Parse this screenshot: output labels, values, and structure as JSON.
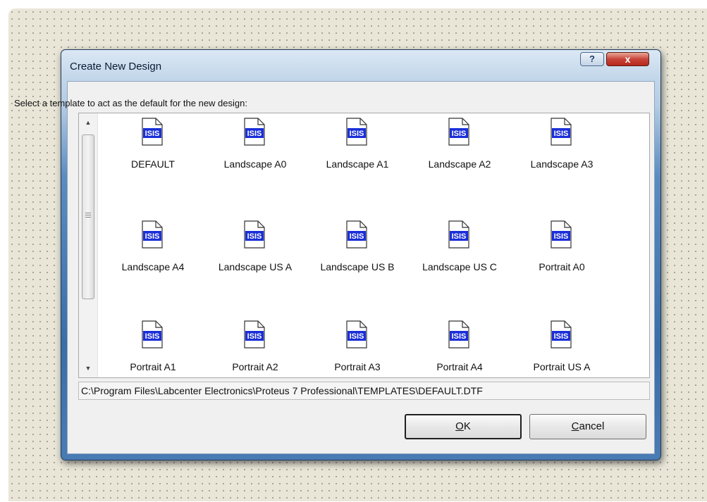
{
  "window": {
    "title": "Create New Design",
    "help_label": "?",
    "close_label": "x"
  },
  "dialog": {
    "instructions": "Select a template to act as the default for the new design:",
    "selected_path": "C:\\Program Files\\Labcenter Electronics\\Proteus 7 Professional\\TEMPLATES\\DEFAULT.DTF"
  },
  "templates": [
    {
      "label": "DEFAULT"
    },
    {
      "label": "Landscape A0"
    },
    {
      "label": "Landscape A1"
    },
    {
      "label": "Landscape A2"
    },
    {
      "label": "Landscape A3"
    },
    {
      "label": "Landscape A4"
    },
    {
      "label": "Landscape US A"
    },
    {
      "label": "Landscape US B"
    },
    {
      "label": "Landscape US C"
    },
    {
      "label": "Portrait A0"
    },
    {
      "label": "Portrait A1"
    },
    {
      "label": "Portrait A2"
    },
    {
      "label": "Portrait A3"
    },
    {
      "label": "Portrait A4"
    },
    {
      "label": "Portrait US A"
    }
  ],
  "icon": {
    "name": "isis-template-icon",
    "badge_text": "ISIS",
    "badge_color": "#1a2fd8"
  },
  "buttons": {
    "ok_first": "O",
    "ok_rest": "K",
    "cancel_first": "C",
    "cancel_rest": "ancel"
  },
  "scrollbar": {
    "up_arrow": "▲",
    "down_arrow": "▼"
  }
}
